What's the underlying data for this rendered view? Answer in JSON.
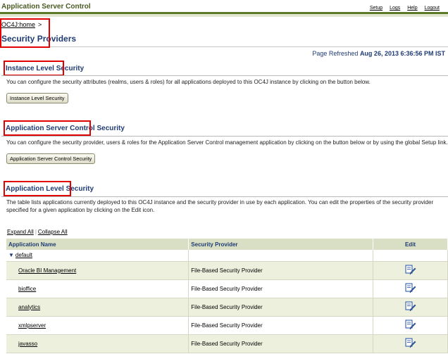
{
  "header": {
    "app_title": "Application Server Control",
    "links": [
      "Setup",
      "Logs",
      "Help",
      "Logout"
    ]
  },
  "breadcrumb": {
    "home": "OC4J:home",
    "separator": ">"
  },
  "page_title": "Security Providers",
  "refreshed": {
    "label": "Page Refreshed",
    "value": "Aug 26, 2013 6:36:56 PM IST"
  },
  "sections": {
    "instance": {
      "heading": "Instance Level Security",
      "description": "You can configure the security attributes (realms, users & roles) for all applications deployed to this OC4J instance by clicking on the button below.",
      "button": "Instance Level Security"
    },
    "asc": {
      "heading": "Application Server Control Security",
      "description": "You can configure the security provider, users & roles for the Application Server Control management application by clicking on the button below or by using the global Setup link.",
      "button": "Application Server Control Security"
    },
    "app": {
      "heading": "Application Level Security",
      "description": "The table lists applications currently deployed to this OC4J instance and the security provider in use by each application. You can edit the properties of the security provider specified for a given application by clicking on the Edit icon."
    }
  },
  "table": {
    "expand_all": "Expand All",
    "collapse_all": "Collapse All",
    "columns": [
      "Application Name",
      "Security Provider",
      "Edit"
    ],
    "group": "default",
    "rows": [
      {
        "name": "Oracle BI Management",
        "provider": "File-Based Security Provider"
      },
      {
        "name": "bioffice",
        "provider": "File-Based Security Provider"
      },
      {
        "name": "analytics",
        "provider": "File-Based Security Provider"
      },
      {
        "name": "xmlpserver",
        "provider": "File-Based Security Provider"
      },
      {
        "name": "javasso",
        "provider": "File-Based Security Provider"
      }
    ]
  },
  "colors": {
    "accent": "#1f3b73",
    "highlight": "#e00000",
    "header_bg": "#d9dfc4"
  },
  "icons": {
    "edit": "pencil-edit-icon",
    "expand": "triangle-down-icon"
  }
}
